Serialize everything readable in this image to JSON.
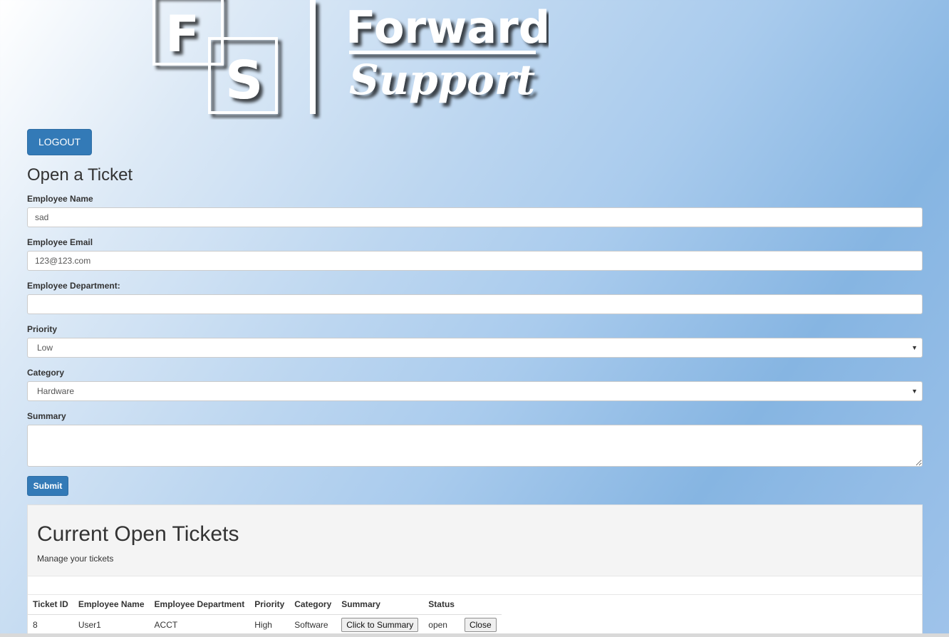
{
  "logo": {
    "mark_letter_1": "F",
    "mark_letter_2": "S",
    "word_1": "Forward",
    "word_2": "Support"
  },
  "header": {
    "logout_label": "LOGOUT"
  },
  "form": {
    "title": "Open a Ticket",
    "name_label": "Employee Name",
    "name_value": "sad",
    "email_label": "Employee Email",
    "email_value": "123@123.com",
    "department_label": "Employee Department:",
    "department_value": "",
    "priority_label": "Priority",
    "priority_value": "Low",
    "category_label": "Category",
    "category_value": "Hardware",
    "summary_label": "Summary",
    "summary_value": "",
    "submit_label": "Submit"
  },
  "tickets": {
    "title": "Current Open Tickets",
    "subtitle": "Manage your tickets",
    "columns": [
      "Ticket ID",
      "Employee Name",
      "Employee Department",
      "Priority",
      "Category",
      "Summary",
      "Status",
      ""
    ],
    "rows": [
      {
        "id": "8",
        "name": "User1",
        "department": "ACCT",
        "priority": "High",
        "category": "Software",
        "summary_button": "Click to Summary",
        "status": "open",
        "close_button": "Close"
      }
    ]
  },
  "colors": {
    "primary": "#337ab7",
    "panel": "#f4f4f4"
  }
}
